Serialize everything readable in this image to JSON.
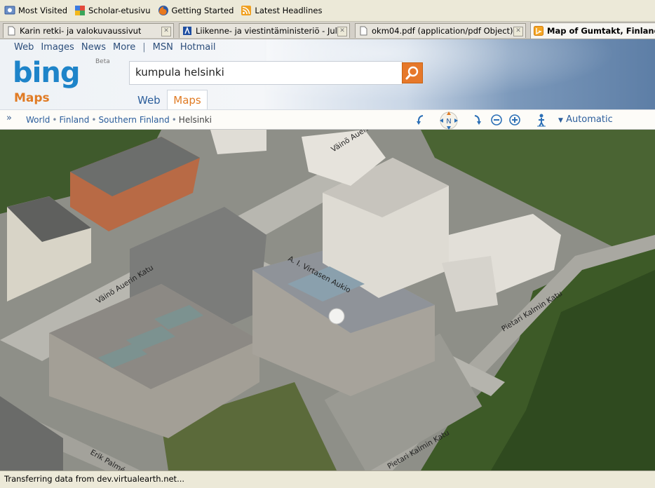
{
  "bookmarks": [
    {
      "label": "Most Visited",
      "icon": "most-visited-icon"
    },
    {
      "label": "Scholar-etusivu",
      "icon": "google-icon"
    },
    {
      "label": "Getting Started",
      "icon": "firefox-icon"
    },
    {
      "label": "Latest Headlines",
      "icon": "rss-icon"
    }
  ],
  "tabs": [
    {
      "title": "Karin retki- ja valokuvaussivut",
      "icon": "page-icon",
      "active": false
    },
    {
      "title": "Liikenne- ja viestintäministeriö - Julkise...",
      "icon": "ministry-icon",
      "active": false
    },
    {
      "title": "okm04.pdf (application/pdf Object)",
      "icon": "page-icon",
      "active": false
    },
    {
      "title": "Map of Gumtakt, Finland - B",
      "icon": "bing-icon",
      "active": true
    }
  ],
  "header": {
    "topnav": [
      "Web",
      "Images",
      "News",
      "More",
      "|",
      "MSN",
      "Hotmail"
    ],
    "logo": "bing",
    "beta": "Beta",
    "section_title": "Maps",
    "search_value": "kumpula helsinki",
    "scopes": {
      "web": "Web",
      "maps": "Maps"
    }
  },
  "breadcrumb": [
    "World",
    "Finland",
    "Southern Finland",
    "Helsinki"
  ],
  "map_controls": {
    "compass_label": "N",
    "style_label": "Automatic"
  },
  "map": {
    "streets": [
      "Väinö Auerin",
      "Väinö Auerin Katu",
      "A. I. Virtasen Aukio",
      "Pietari Kalmin Katu",
      "Pietari Kalmin Katu",
      "Erik Palmé"
    ]
  },
  "status": "Transferring data from dev.virtualearth.net...",
  "colors": {
    "bing_blue": "#1e84c9",
    "maps_orange": "#e07b24",
    "link_blue": "#2b5d9b"
  }
}
